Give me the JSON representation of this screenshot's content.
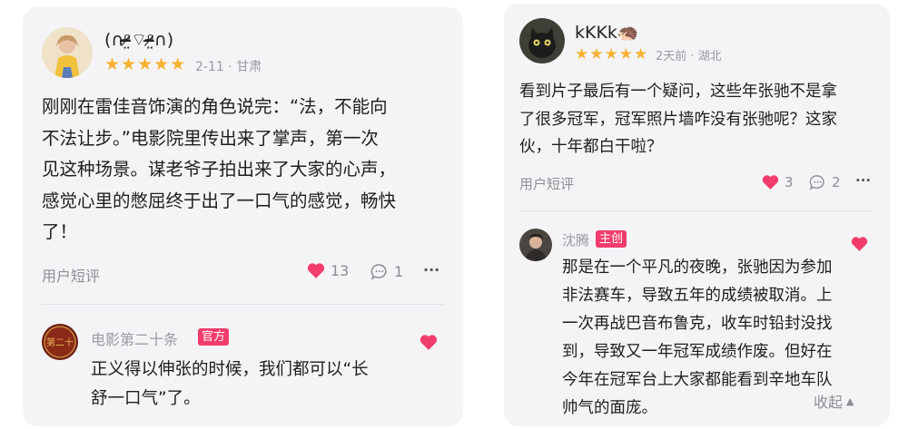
{
  "left": {
    "user_name": "(∩ᵒ̴̶̷̤⌔ᵒ̴̶̷̤∩)",
    "rating_stars": 5,
    "meta": "2-11 · 甘肃",
    "content_lines": [
      "刚刚在雷佳音饰演的角色说完：“法，不能向",
      "不法让步。”电影院里传出来了掌声，第一次",
      "见这种场景。谋老爷子拍出来了大家的心声，",
      "感觉心里的憋屈终于出了一口气的感觉，畅快",
      "了！"
    ],
    "tag": "用户短评",
    "likes": "13",
    "comments": "1",
    "more": "···",
    "reply": {
      "name": "电影第二十条",
      "badge": "官方",
      "content_lines": [
        "正义得以伸张的时候，我们都可以“长",
        "舒一口气”了。"
      ]
    }
  },
  "right": {
    "user_name": "kKKk🦔",
    "rating_stars": 5,
    "meta": "2天前 · 湖北",
    "content_lines": [
      "看到片子最后有一个疑问，这些年张驰不是拿",
      "了很多冠军，冠军照片墙咋没有张驰呢？这家",
      "伙，十年都白干啦？"
    ],
    "tag": "用户短评",
    "likes": "3",
    "comments": "2",
    "more": "···",
    "reply": {
      "name": "沈腾",
      "badge": "主创",
      "content_lines": [
        "那是在一个平凡的夜晚，张驰因为参加",
        "非法赛车，导致五年的成绩被取消。上",
        "一次再战巴音布鲁克，收车时铅封没找",
        "到，导致又一年冠军成绩作废。但好在",
        "今年在冠军台上大家都能看到辛地车队",
        "帅气的面庞。"
      ],
      "collapse_label": "收起"
    }
  },
  "colors": {
    "star": "#f7b233",
    "heart": "#f23c6c",
    "badge": "#f23c6c",
    "card_bg": "#f4f4f6"
  },
  "icons": [
    "star-icon",
    "heart-icon",
    "comment-icon",
    "more-icon",
    "collapse-up-icon"
  ]
}
